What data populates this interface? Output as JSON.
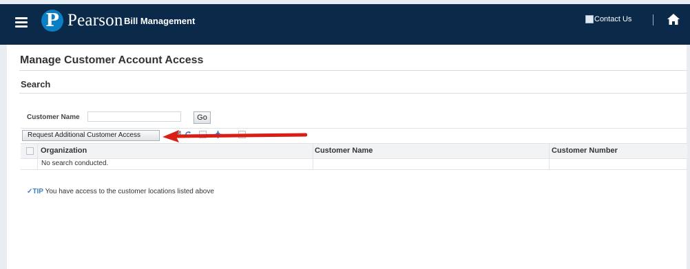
{
  "header": {
    "logo_letter": "P",
    "brand": "Pearson",
    "app_name": "Bill Management",
    "contact_label": "Contact Us",
    "bg_color": "#0b2a4a"
  },
  "page": {
    "title": "Manage Customer Account Access",
    "section": "Search"
  },
  "search": {
    "customer_name_label": "Customer Name",
    "customer_name_value": "",
    "go_label": "Go"
  },
  "toolbar": {
    "request_button_label": "Request Additional Customer Access"
  },
  "table": {
    "columns": [
      "Organization",
      "Customer Name",
      "Customer Number"
    ],
    "empty_message": "No search conducted."
  },
  "tip": {
    "label": "TIP",
    "text": "You have access to the customer locations listed above"
  },
  "annotation": {
    "arrow_color": "#d91e18"
  }
}
